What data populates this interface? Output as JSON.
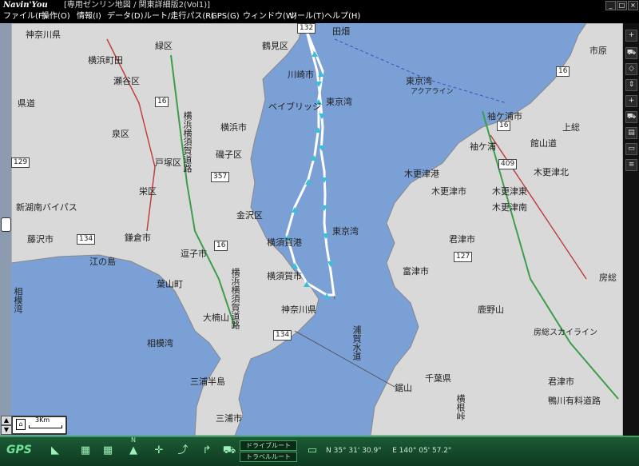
{
  "window": {
    "logo": "Navin'You",
    "title": "[専用ゼンリン地図 / 関東詳細版2(Vol1)]",
    "minimize": "_",
    "maximize": "□",
    "close": "×"
  },
  "menu": {
    "items": [
      "ファイル(F)",
      "操作(O)",
      "情報(I)",
      "データ(D)",
      "ルート/走行パス(R)",
      "GPS(G)",
      "ウィンドウ(W)",
      "ツール(T)",
      "ヘルプ(H)"
    ]
  },
  "map": {
    "labels": {
      "kanagawa_top": "神奈川県",
      "yokohama_machida": "横浜町田",
      "seya": "瀬谷区",
      "tsuzuki": "緑区",
      "yokohama": "横浜市",
      "izumi": "泉区",
      "totsuka": "戸塚区",
      "sakae": "栄区",
      "shonan_bypass": "新湖南バイパス",
      "fujisawa": "藤沢市",
      "kamakura": "鎌倉市",
      "enoshima": "江の島",
      "hayama": "葉山町",
      "zushi": "逗子市",
      "yokohama_yokosuka_road": "横浜横須賀道路",
      "yokosuka_road2": "横浜横須賀道路",
      "kanazawa": "金沢区",
      "isogo": "磯子区",
      "tsurumi": "鶴見区",
      "bay_bridge": "ベイブリッジ",
      "kawasaki": "川崎市",
      "tokyo_bay_top": "東京湾",
      "tokyo_bay_mid": "東京湾",
      "yokosuka_port": "横須賀港",
      "yokosuka_city": "横須賀市",
      "kanagawa_pref": "神奈川県",
      "sagami_bay": "相模湾",
      "sagami_bay2": "相模湾",
      "ogusu": "大楠山",
      "miura_peninsula": "三浦半島",
      "miura_city": "三浦市",
      "uraga_channel": "浦賀水道",
      "tokyo_wan_aqualine": "東京湾",
      "aqualine": "アクアライン",
      "kisarazu_port": "木更津港",
      "kisarazu_city": "木更津市",
      "sodegaura": "袖ケ浦",
      "sodegaura_city": "袖ケ浦市",
      "kimitsu": "君津市",
      "futtsu": "富津市",
      "tateyama_road": "館山道",
      "kisarazu_north": "木更津北",
      "kisarazu_east": "木更津東",
      "kisarazu_south": "木更津南",
      "ichihara": "市原",
      "kazusa": "上総",
      "kanozan": "鹿野山",
      "boso": "房総",
      "boso_skyline": "房総スカイライン",
      "kimitsu_city": "君津市",
      "kamogawa_road": "鴨川有料道路",
      "chiba_pref": "千葉県",
      "nokogiriyama": "鋸山",
      "yokone": "横根峠",
      "ken_road": "県道",
      "kanagawa_ken_road": "神奈川県",
      "tabata": "田畑"
    },
    "route_signs": {
      "r132": "132",
      "r16a": "16",
      "r16b": "16",
      "r16c": "16",
      "r16d": "16",
      "r129": "129",
      "r134a": "134",
      "r134b": "134",
      "r357": "357",
      "r409": "409",
      "r127": "127"
    },
    "scale": "3Km",
    "north_label": "N"
  },
  "status": {
    "gps_label": "GPS",
    "drive_route": "ドライブルート",
    "travel_route": "トラベルルート",
    "latitude": "N  35° 31' 30.9\"",
    "longitude": "E 140° 05' 57.2\""
  },
  "colors": {
    "sea": "#7ba0d6",
    "land": "#d8d8d8",
    "route": "#ffffff",
    "route_arrow": "#37c0d8",
    "status_green": "#1d5a35"
  }
}
